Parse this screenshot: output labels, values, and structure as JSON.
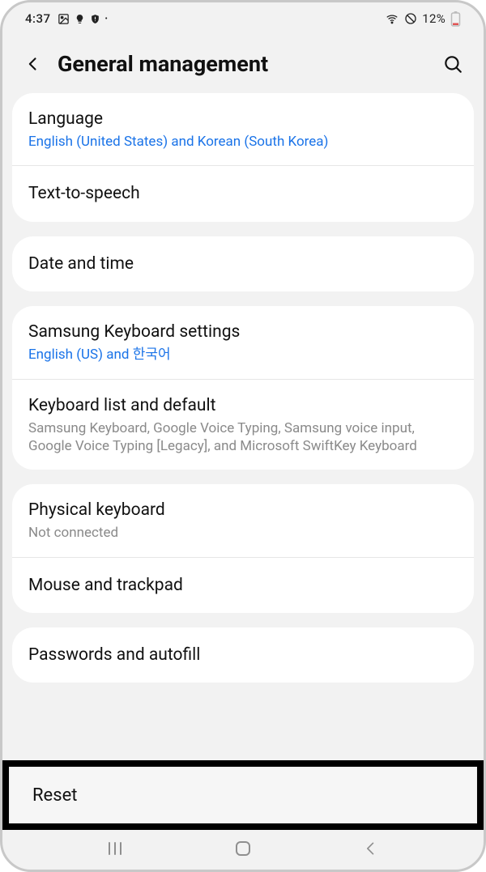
{
  "statusbar": {
    "time": "4:37",
    "battery_pct": "12%"
  },
  "header": {
    "title": "General management"
  },
  "groups": [
    {
      "items": [
        {
          "title": "Language",
          "sub": "English (United States) and Korean (South Korea)",
          "sub_style": "link"
        },
        {
          "title": "Text-to-speech"
        }
      ]
    },
    {
      "items": [
        {
          "title": "Date and time"
        }
      ]
    },
    {
      "items": [
        {
          "title": "Samsung Keyboard settings",
          "sub": "English (US) and 한국어",
          "sub_style": "link"
        },
        {
          "title": "Keyboard list and default",
          "sub": "Samsung Keyboard, Google Voice Typing, Samsung voice input, Google Voice Typing [Legacy], and Microsoft SwiftKey Keyboard",
          "sub_style": "muted"
        }
      ]
    },
    {
      "items": [
        {
          "title": "Physical keyboard",
          "sub": "Not connected",
          "sub_style": "muted"
        },
        {
          "title": "Mouse and trackpad"
        }
      ]
    },
    {
      "items": [
        {
          "title": "Passwords and autofill"
        }
      ]
    }
  ],
  "highlight": {
    "label": "Reset"
  }
}
